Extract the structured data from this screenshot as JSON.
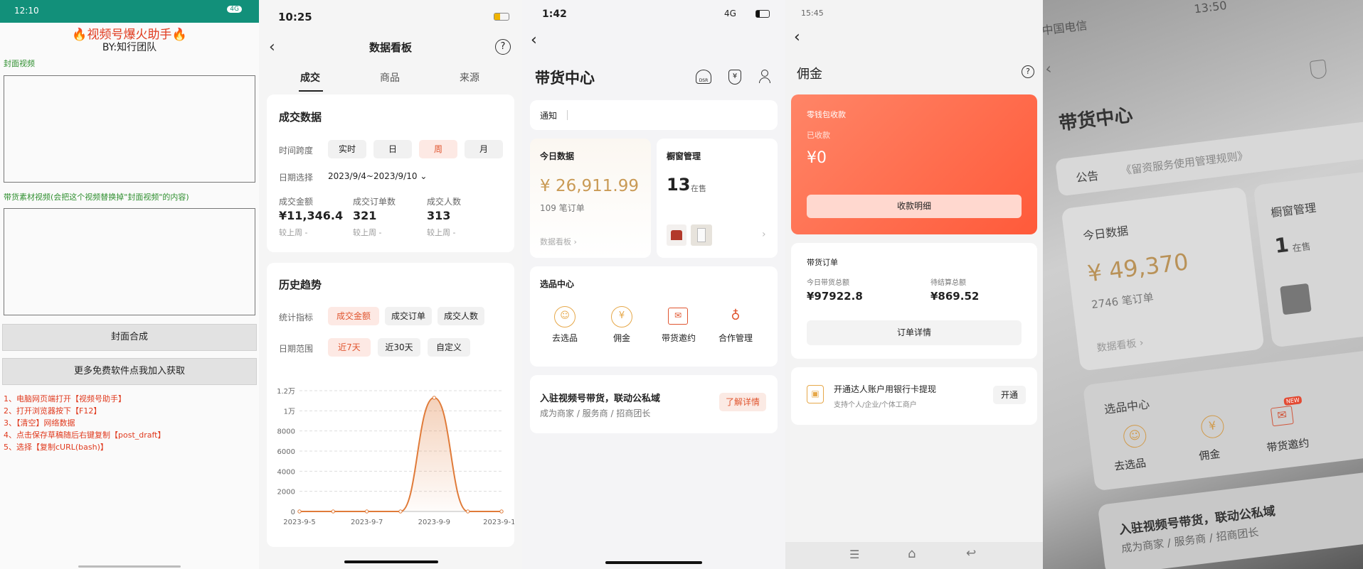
{
  "p1": {
    "status_time": "12:10",
    "status_right": "4G",
    "title": "🔥视频号爆火助手🔥",
    "subtitle": "BY:知行团队",
    "label_cover": "封面视频",
    "label_material": "带货素材视频(会把这个视频替换掉\"封面视频\"的内容)",
    "btn_compose": "封面合成",
    "btn_more": "更多免费软件点我加入获取",
    "steps": [
      "1、电脑网页端打开【视频号助手】",
      "2、打开浏览器按下【F12】",
      "3、【清空】网络数据",
      "4、点击保存草稿随后右键复制【post_draft】",
      "5、选择【复制cURL(bash)】"
    ]
  },
  "p2": {
    "status_time": "10:25",
    "nav_title": "数据看板",
    "help": "?",
    "tabs": [
      "成交",
      "商品",
      "来源"
    ],
    "deal_title": "成交数据",
    "time_span_label": "时间跨度",
    "time_opts": [
      "实时",
      "日",
      "周",
      "月"
    ],
    "date_label": "日期选择",
    "date_value": "2023/9/4~2023/9/10",
    "metrics": [
      {
        "label": "成交金额",
        "value": "¥11,346.4",
        "cmp": "较上周 -"
      },
      {
        "label": "成交订单数",
        "value": "321",
        "cmp": "较上周 -"
      },
      {
        "label": "成交人数",
        "value": "313",
        "cmp": "较上周 -"
      }
    ],
    "history_title": "历史趋势",
    "stat_label": "统计指标",
    "stat_opts": [
      "成交金额",
      "成交订单",
      "成交人数"
    ],
    "range_label": "日期范围",
    "range_opts": [
      "近7天",
      "近30天",
      "自定义"
    ]
  },
  "chart_data": {
    "type": "area",
    "x": [
      "2023-9-5",
      "2023-9-6",
      "2023-9-7",
      "2023-9-8",
      "2023-9-9",
      "2023-9-10",
      "2023-9-11"
    ],
    "y_values": [
      0,
      0,
      0,
      0,
      11300,
      0,
      0
    ],
    "xticks": [
      "2023-9-5",
      "2023-9-7",
      "2023-9-9",
      "2023-9-11"
    ],
    "yticks": [
      "0",
      "2000",
      "4000",
      "6000",
      "8000",
      "1万",
      "1.2万"
    ],
    "ylim": [
      0,
      12000
    ],
    "color": "#e07b39"
  },
  "p3": {
    "status_time": "1:42",
    "status_net": "4G",
    "title": "带货中心",
    "dsr": "DSR",
    "notice": "通知",
    "today_title": "今日数据",
    "today_amount": "¥ 26,911.99",
    "today_orders": "109 笔订单",
    "today_link": "数据看板 ›",
    "window_title": "橱窗管理",
    "window_count": "13",
    "window_unit": "在售",
    "select_title": "选品中心",
    "select_items": [
      "去选品",
      "佣金",
      "带货邀约",
      "合作管理"
    ],
    "banner_title": "入驻视频号带货，联动公私域",
    "banner_sub": "成为商家 / 服务商 / 招商团长",
    "banner_btn": "了解详情"
  },
  "p4": {
    "status_time": "15:45",
    "title": "佣金",
    "help": "?",
    "card_label1": "零钱包收款",
    "card_label2": "已收款",
    "card_amount": "¥0",
    "card_btn": "收款明细",
    "order_title": "带货订单",
    "order_today_label": "今日带货总额",
    "order_today_value": "¥97922.8",
    "order_pending_label": "待结算总额",
    "order_pending_value": "¥869.52",
    "order_btn": "订单详情",
    "bank_title": "开通达人账户用银行卡提现",
    "bank_sub": "支持个人/企业/个体工商户",
    "bank_btn": "开通"
  },
  "p5": {
    "carrier": "中国电信",
    "status_time": "13:50",
    "title": "带货中心",
    "notice_label": "公告",
    "notice_text": "《留资服务使用管理规则》",
    "today_title": "今日数据",
    "today_amount": "¥ 49,370",
    "today_orders": "2746 笔订单",
    "today_link": "数据看板 ›",
    "window_title": "橱窗管理",
    "window_count": "1",
    "window_unit": "在售",
    "select_title": "选品中心",
    "select_items": [
      "去选品",
      "佣金",
      "带货邀约"
    ],
    "new_badge": "NEW",
    "banner_title": "入驻视频号带货，联动公私域",
    "banner_sub": "成为商家 / 服务商 / 招商团长"
  }
}
